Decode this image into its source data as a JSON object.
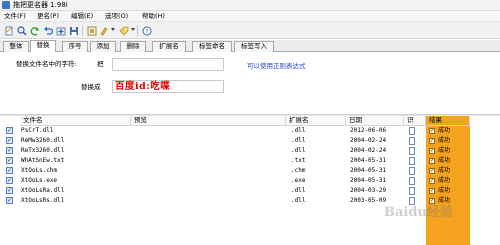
{
  "window": {
    "title": "拖把更名器 1.98i"
  },
  "menu": [
    "文件(F)",
    "更名(P)",
    "编辑(E)",
    "选项(O)",
    "帮助(H)"
  ],
  "toolbar": {
    "icons": [
      "new-icon",
      "search-icon",
      "refresh-icon",
      "undo-icon",
      "add-icon",
      "save-icon",
      "options-icon",
      "brush-icon",
      "tag-icon",
      "help-icon"
    ]
  },
  "tabs": [
    "整体",
    "替换",
    "序号",
    "添加",
    "删除",
    "扩展名",
    "标签命名",
    "标签写入"
  ],
  "active_tab": "替换",
  "replace": {
    "find_label": "替换文件名中的字符:",
    "find_prefix": "把",
    "find_value": "",
    "replace_label": "替换成",
    "replace_value": "百度id:吃喋",
    "regex_hint": "可以使用正则表达式"
  },
  "table": {
    "columns": [
      "文件名",
      "预览",
      "扩展名",
      "日期",
      "识",
      "结果"
    ],
    "rows": [
      {
        "name": "PsCrT.dll",
        "preview": "",
        "ext": ".dll",
        "date": "2012-06-06",
        "result": "成功"
      },
      {
        "name": "ReMw3260.dll",
        "preview": "",
        "ext": ".dll",
        "date": "2004-02-24",
        "result": "成功"
      },
      {
        "name": "ReTx3260.dll",
        "preview": "",
        "ext": ".dll",
        "date": "2004-02-24",
        "result": "成功"
      },
      {
        "name": "WhAtSnEw.txt",
        "preview": "",
        "ext": ".txt",
        "date": "2004-05-31",
        "result": "成功"
      },
      {
        "name": "XtOoLs.chm",
        "preview": "",
        "ext": ".chm",
        "date": "2004-05-31",
        "result": "成功"
      },
      {
        "name": "XtOoLs.exe",
        "preview": "",
        "ext": ".exe",
        "date": "2004-05-31",
        "result": "成功"
      },
      {
        "name": "XtOoLsRa.dll",
        "preview": "",
        "ext": ".dll",
        "date": "2004-03-29",
        "result": "成功"
      },
      {
        "name": "XtOoLsRs.dll",
        "preview": "",
        "ext": ".dll",
        "date": "2003-05-09",
        "result": "成功"
      }
    ]
  },
  "watermark": "Baidu经验",
  "colors": {
    "accent_result": "#f5a21e",
    "replace_text": "#e00000",
    "link": "#1d3fd0"
  }
}
